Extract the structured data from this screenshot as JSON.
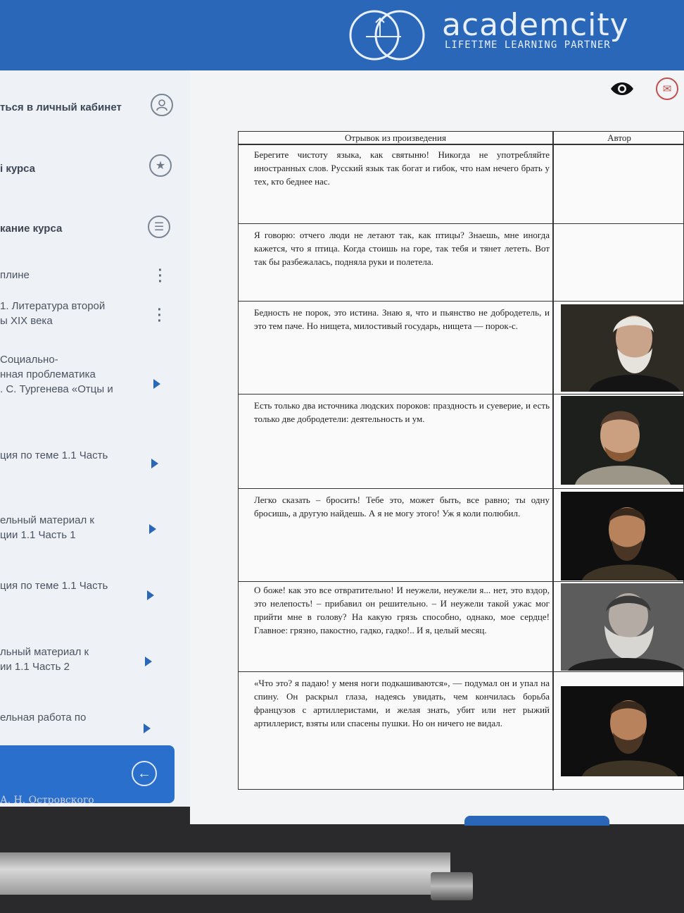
{
  "header": {
    "brand_name": "academcity",
    "brand_tagline": "LIFETIME LEARNING PARTNER",
    "color": "#2a67b8"
  },
  "sidebar": {
    "items": [
      {
        "label": "ться в личный кабинет",
        "icon": "user-icon",
        "style": "bold"
      },
      {
        "label": "і курса",
        "icon": "star-icon",
        "style": "bold"
      },
      {
        "label": "кание курса",
        "icon": "list-icon",
        "style": "bold"
      },
      {
        "label": "плине",
        "icon": "kebab-icon"
      },
      {
        "label": "1. Литература второй\nы XIX века",
        "icon": "kebab-icon"
      },
      {
        "label": "Социально-\nнная проблематика\n. С. Тургенева «Отцы и",
        "icon": "play-arrow-icon"
      },
      {
        "label": "ция по теме 1.1 Часть",
        "icon": "play-arrow-icon"
      },
      {
        "label": "ельный материал к\nции 1.1 Часть 1",
        "icon": "play-arrow-icon"
      },
      {
        "label": "ция по теме 1.1 Часть",
        "icon": "play-arrow-icon"
      },
      {
        "label": "льный материал к\nии 1.1 Часть 2",
        "icon": "play-arrow-icon"
      },
      {
        "label": "ельная работа по",
        "icon": "play-arrow-icon"
      }
    ],
    "back_icon": "arrow-left-icon",
    "bottom_caption": "А. Н. Островского"
  },
  "toolbar": {
    "icons": [
      "eye-icon",
      "mail-icon"
    ]
  },
  "table": {
    "headers": [
      "Отрывок из произведения",
      "Автор"
    ],
    "rows": [
      {
        "text": "Берегите чистоту языка, как святыню! Никогда не употребляйте иностранных слов. Русский язык так богат и гибок, что нам нечего брать у тех, кто беднее нас.",
        "portrait": null
      },
      {
        "text": "Я говорю: отчего люди не летают так, как птицы? Знаешь, мне иногда кажется, что я птица. Когда стоишь на горе, так тебя и тянет лететь. Вот так бы разбежалась, подняла руки и полетела.",
        "portrait": null
      },
      {
        "text": "Бедность не порок, это истина. Знаю я, что и пьянство не добродетель, и это тем паче. Но нищета, милостивый государь, нищета — порок-с.",
        "portrait": "portrait-white-beard"
      },
      {
        "text": "Есть только два источника людских пороков: праздность и суеверие, и есть только две добродетели: деятельность и ум.",
        "portrait": "portrait-fur-collar"
      },
      {
        "text": "Легко сказать – бросить! Тебе это, может быть, все равно; ты одну бросишь, а другую найдешь. А я не могу этого! Уж я коли полюбил.",
        "portrait": "portrait-dark-beard"
      },
      {
        "text": "О боже! как это все отвратительно! И неужели, неужели я... нет, это вздор, это нелепость! – прибавил он решительно. – И неужели такой ужас мог прийти мне в голову? На какую грязь способно, однако, мое сердце! Главное: грязно, пакостно, гадко, гадко!.. И я, целый месяц.",
        "portrait": "portrait-gray-beard"
      },
      {
        "text": "«Что это? я падаю! у меня ноги подкашиваются», — подумал он и упал на спину. Он раскрыл глаза, надеясь увидать, чем кончилась борьба французов с артиллеристами, и желая знать, убит или нет рыжий артиллерист, взяты или спасены пушки. Но он ничего не видал.",
        "portrait": "portrait-dark-beard-2"
      }
    ]
  }
}
